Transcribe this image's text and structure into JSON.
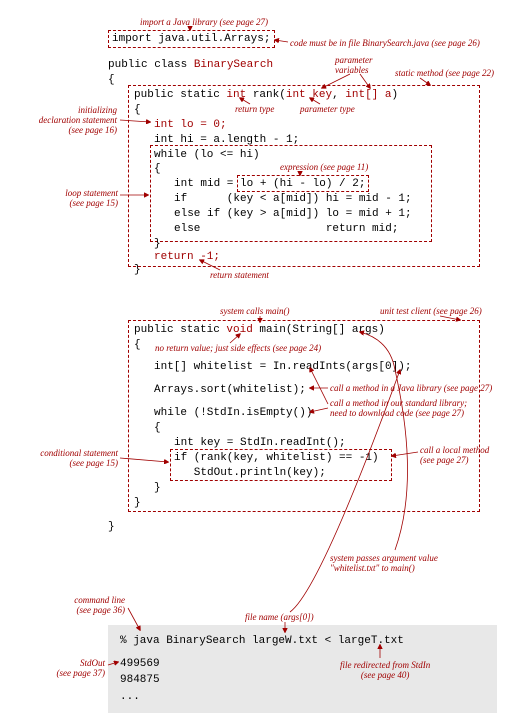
{
  "labels": {
    "importLib": "import a Java library (see page 27)",
    "mustBeInFile": "code must be in file BinarySearch.java (see page 26)",
    "paramVars": "parameter\nvariables",
    "staticMethod": "static method (see page 22)",
    "initDecl": "initializing\ndeclaration statement\n(see page 16)",
    "returnType": "return type",
    "paramType": "parameter type",
    "loopStmt": "loop statement\n(see page 15)",
    "expression": "expression (see page 11)",
    "returnStmt": "return statement",
    "systemCallsMain": "system calls main()",
    "unitTest": "unit test client (see page 26)",
    "noReturn": "no return value; just side effects (see page 24)",
    "callJavaLib": "call a method in a Java library (see page 27)",
    "callStdLib": "call a method in our standard library;\nneed to download code (see page 27)",
    "condStmt": "conditional statement\n(see page 15)",
    "callLocal": "call a local method\n(see page 27)",
    "sysPassesArg": "system passes argument value\n\"whitelist.txt\" to main()",
    "cmdLine": "command line\n(see page 36)",
    "fileName": "file name (args[0])",
    "stdOut": "StdOut\n(see page 37)",
    "fileRedirect": "file redirected from StdIn\n(see page 40)"
  },
  "code": {
    "importLine": "import java.util.Arrays;",
    "classDecl1": "public class ",
    "className": "BinarySearch",
    "openBrace": "{",
    "rankSig1": "public static ",
    "rankRet": "int",
    "rankSig2": " rank(",
    "rankP1t": "int",
    "rankP1n": " key",
    "rankSep": ", ",
    "rankP2t": "int[]",
    "rankP2n": " a",
    "rankSig3": ")",
    "lo": "int lo = 0;",
    "hi": "int hi = a.length - 1;",
    "whileCond": "while (lo <= hi)",
    "midLine1": "int mid = ",
    "midExpr": "lo + (hi - lo) / 2;",
    "ifLine": "if      (key < a[mid]) hi = mid - 1;",
    "elseIfLine": "else if (key > a[mid]) lo = mid + 1;",
    "elseLine": "else                   return mid;",
    "returnNeg1": "return -1;",
    "mainSig1": "public static ",
    "mainVoid": "void",
    "mainSig2": " main(String[] args)",
    "whitelist": "int[] whitelist = In.readInts(args[0]);",
    "sort": "Arrays.sort(whitelist);",
    "whileStdIn": "while (!StdIn.isEmpty())",
    "readKey": "int key = StdIn.readInt();",
    "ifRank": "if (rank(key, whitelist) == -1)",
    "println": "   StdOut.println(key);",
    "closeBrace": "}"
  },
  "shell": {
    "cmd": "% java BinarySearch largeW.txt < largeT.txt",
    "out1": "499569",
    "out2": "984875",
    "out3": "..."
  }
}
